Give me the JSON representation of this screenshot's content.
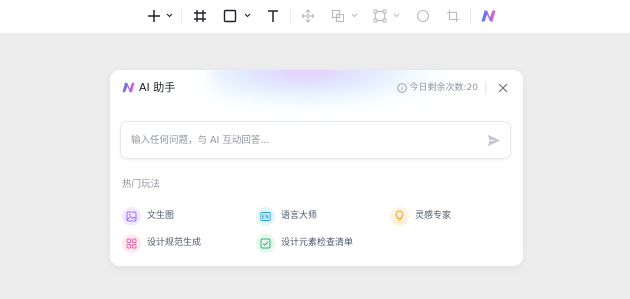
{
  "toolbar": {
    "tools": [
      {
        "name": "add",
        "icon": "plus-icon",
        "has_menu": true
      },
      {
        "name": "frame",
        "icon": "frame-icon",
        "has_menu": false
      },
      {
        "name": "rectangle",
        "icon": "rectangle-icon",
        "has_menu": true
      },
      {
        "name": "text",
        "icon": "text-icon",
        "has_menu": false
      },
      {
        "name": "move",
        "icon": "move-icon",
        "has_menu": false
      },
      {
        "name": "boolean",
        "icon": "boolean-icon",
        "has_menu": true
      },
      {
        "name": "path",
        "icon": "path-icon",
        "has_menu": true
      },
      {
        "name": "ellipse",
        "icon": "circle-icon",
        "has_menu": false
      },
      {
        "name": "crop",
        "icon": "crop-icon",
        "has_menu": false
      },
      {
        "name": "ai",
        "icon": "ai-logo-icon",
        "has_menu": false
      }
    ]
  },
  "panel": {
    "title": "AI 助手",
    "quota": "今日剩余次数:20",
    "input": {
      "value": "",
      "placeholder": "输入任何问题，与 AI 互动回答..."
    },
    "section_title": "热门玩法",
    "features": [
      {
        "label": "文生图",
        "icon": "image-icon",
        "color": "#9b6df5",
        "bg": "#f1eafe"
      },
      {
        "label": "语言大师",
        "icon": "en-icon",
        "color": "#2fa7d6",
        "bg": "#e3f4fb"
      },
      {
        "label": "灵感专家",
        "icon": "lightbulb-icon",
        "color": "#f5a623",
        "bg": "#fef3e2"
      },
      {
        "label": "设计规范生成",
        "icon": "grid-icon",
        "color": "#f0569a",
        "bg": "#fdeaf2"
      },
      {
        "label": "设计元素检查清单",
        "icon": "checklist-icon",
        "color": "#2bb673",
        "bg": "#e5f7ee"
      }
    ]
  },
  "colors": {
    "canvas": "#ededed",
    "accent_gradient": [
      "#5b7cfa",
      "#e05fd2"
    ]
  }
}
